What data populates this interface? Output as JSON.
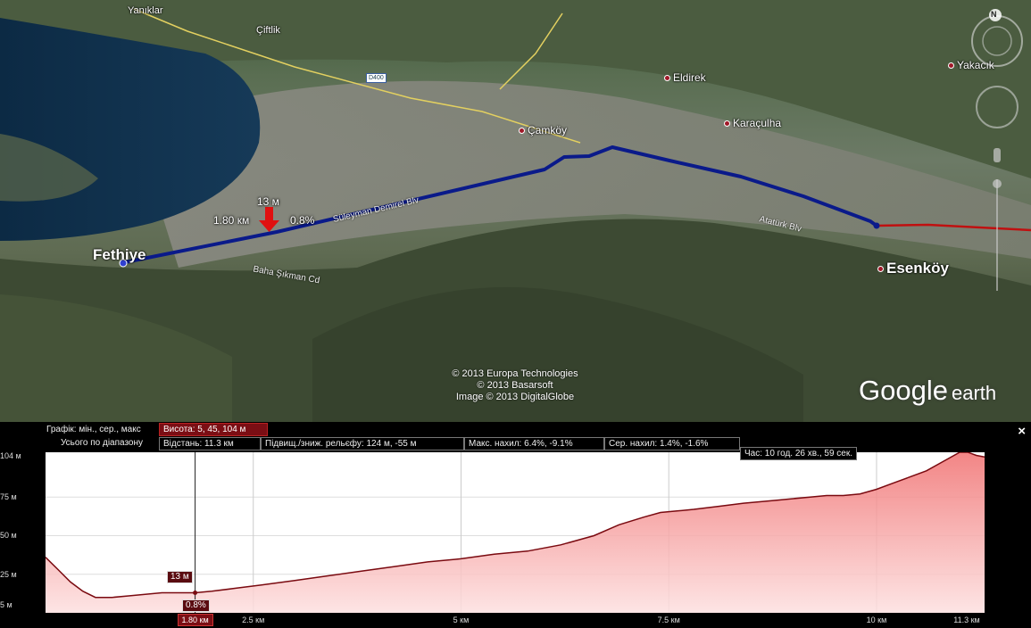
{
  "map": {
    "places": {
      "yaniklar": "Yanıklar",
      "ciftlik": "Çiftlik",
      "eldirek": "Eldirek",
      "yakacik": "Yakacık",
      "camkoy": "Çamköy",
      "karaculha": "Karaçulha",
      "fethiye": "Fethiye",
      "esenkoy": "Esenköy"
    },
    "roads": {
      "suleyman": "Süleyman Demirel Blv",
      "ataturk": "Atatürk Blv",
      "baha": "Baha Şıkman Cd"
    },
    "shield": "D400",
    "marker": {
      "elevation": "13 м",
      "distance": "1.80 км",
      "slope": "0.8%"
    },
    "credits": [
      "© 2013 Europa Technologies",
      "© 2013 Basarsoft",
      "Image © 2013 DigitalGlobe"
    ],
    "logo": {
      "brand": "Google",
      "product": "earth"
    },
    "compass": "N",
    "colors": {
      "track": "#0a1a8a",
      "track_red": "#c01010",
      "marker": "#e01010"
    }
  },
  "profile": {
    "header": {
      "graph_label": "Графік: мін., сер., макс",
      "elevation": "Висота: 5, 45, 104 м",
      "range_label": "Усього по діапазону",
      "distance": "Відстань: 11.3 км",
      "gain_loss": "Підвищ./зниж. рельєфу: 124 м, -55 м",
      "max_slope": "Макс. нахил: 6.4%, -9.1%",
      "avg_slope": "Сер. нахил: 1.4%, -1.6%",
      "time": "Час: 10 год. 26 хв., 59 сек."
    },
    "close": "×",
    "tooltip_elev": "13 м",
    "tooltip_slope": "0.8%",
    "colors": {
      "line": "#7a0a10",
      "fill_top": "#f07070",
      "fill_bottom": "#fde0e0",
      "selected": "#7b0e14"
    }
  },
  "chart_data": {
    "type": "area",
    "xlabel": "",
    "ylabel": "",
    "xlim": [
      0,
      11.3
    ],
    "ylim": [
      0,
      104
    ],
    "x_ticks": [
      {
        "v": 1.8,
        "label": "1.80 км",
        "selected": true
      },
      {
        "v": 2.5,
        "label": "2.5 км"
      },
      {
        "v": 5,
        "label": "5 км"
      },
      {
        "v": 7.5,
        "label": "7.5 км"
      },
      {
        "v": 10,
        "label": "10 км"
      },
      {
        "v": 11.3,
        "label": "11.3 км"
      }
    ],
    "y_ticks": [
      {
        "v": 104,
        "label": "104 м"
      },
      {
        "v": 75,
        "label": "75 м"
      },
      {
        "v": 50,
        "label": "50 м"
      },
      {
        "v": 25,
        "label": "25 м"
      },
      {
        "v": 5,
        "label": "5 м"
      }
    ],
    "gridlines_x": [
      2.5,
      5,
      7.5,
      10
    ],
    "gridlines_y": [
      25,
      50,
      75
    ],
    "cursor_x": 1.8,
    "series": [
      {
        "x": [
          0,
          0.15,
          0.3,
          0.45,
          0.6,
          0.8,
          1.0,
          1.2,
          1.4,
          1.6,
          1.8,
          2.0,
          2.3,
          2.6,
          3.0,
          3.4,
          3.8,
          4.2,
          4.6,
          5.0,
          5.4,
          5.8,
          6.2,
          6.6,
          6.9,
          7.2,
          7.4,
          7.6,
          7.8,
          8.1,
          8.4,
          8.8,
          9.2,
          9.4,
          9.6,
          9.8,
          10.0,
          10.2,
          10.4,
          10.6,
          10.8,
          11.0,
          11.1,
          11.2,
          11.3
        ],
        "y": [
          36,
          28,
          20,
          14,
          10,
          10,
          11,
          12,
          13,
          13,
          13,
          14,
          16,
          18,
          21,
          24,
          27,
          30,
          33,
          35,
          38,
          40,
          44,
          50,
          57,
          62,
          65,
          66,
          67,
          69,
          71,
          73,
          75,
          76,
          76,
          77,
          80,
          84,
          88,
          92,
          98,
          104,
          104,
          102,
          101
        ]
      }
    ]
  }
}
